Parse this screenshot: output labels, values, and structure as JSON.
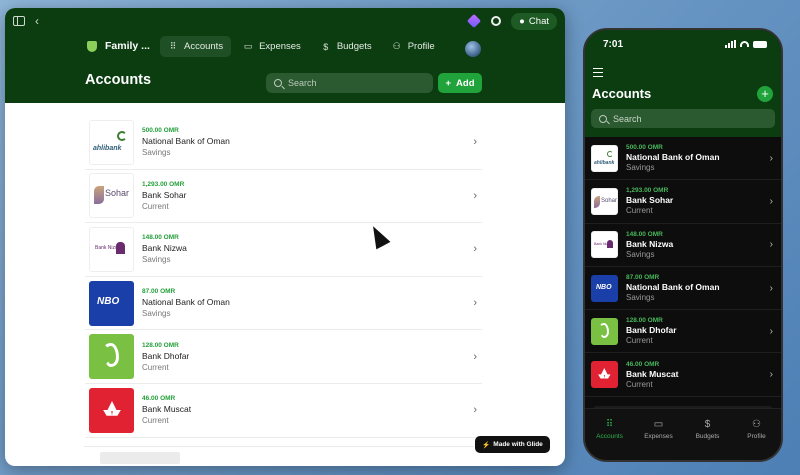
{
  "tablet": {
    "toolbar": {
      "chat_label": "Chat"
    },
    "header": {
      "app_name": "Family ...",
      "nav": [
        {
          "label": "Accounts",
          "icon": "grid-icon",
          "active": true
        },
        {
          "label": "Expenses",
          "icon": "card-icon",
          "active": false
        },
        {
          "label": "Budgets",
          "icon": "dollar-icon",
          "active": false
        },
        {
          "label": "Profile",
          "icon": "person-icon",
          "active": false
        }
      ],
      "page_title": "Accounts",
      "search_placeholder": "Search",
      "add_label": "Add"
    },
    "badge": "Made with Glide"
  },
  "phone": {
    "time": "7:01",
    "title": "Accounts",
    "search_placeholder": "Search",
    "tabs": [
      {
        "label": "Accounts",
        "active": true
      },
      {
        "label": "Expenses",
        "active": false
      },
      {
        "label": "Budgets",
        "active": false
      },
      {
        "label": "Profile",
        "active": false
      }
    ]
  },
  "accounts": [
    {
      "amount": "500.00 OMR",
      "bank": "National Bank of Oman",
      "type": "Savings",
      "logo": "ahlibank",
      "logo_text": "ahlibank"
    },
    {
      "amount": "1,293.00 OMR",
      "bank": "Bank Sohar",
      "type": "Current",
      "logo": "sohar",
      "logo_text": "Sohar"
    },
    {
      "amount": "148.00 OMR",
      "bank": "Bank Nizwa",
      "type": "Savings",
      "logo": "nizwa",
      "logo_text": "Bank Nizwa"
    },
    {
      "amount": "87.00 OMR",
      "bank": "National Bank of Oman",
      "type": "Savings",
      "logo": "nbo",
      "logo_text": "NBO"
    },
    {
      "amount": "128.00 OMR",
      "bank": "Bank Dhofar",
      "type": "Current",
      "logo": "dhofar",
      "logo_text": ""
    },
    {
      "amount": "46.00 OMR",
      "bank": "Bank Muscat",
      "type": "Current",
      "logo": "muscat",
      "logo_text": ""
    }
  ],
  "colors": {
    "brand_dark": "#0b3d11",
    "accent_green": "#20a33a",
    "amount_green": "#23a03a"
  }
}
